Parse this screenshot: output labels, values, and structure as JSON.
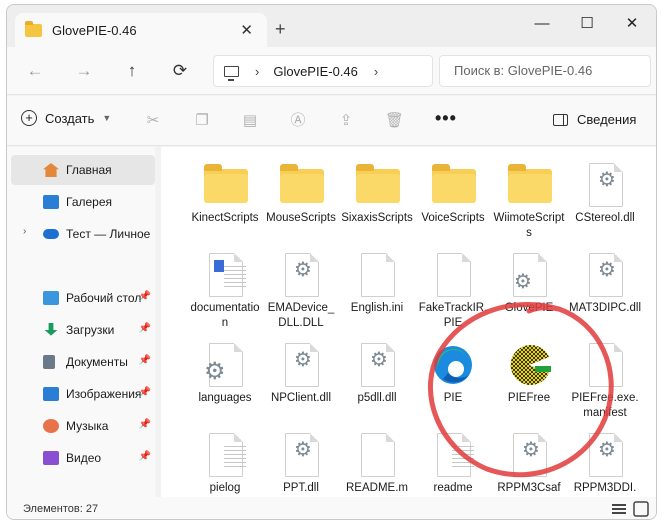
{
  "window": {
    "tab_title": "GlovePIE-0.46",
    "new_tab": "+",
    "close_tab": "✕",
    "minimize": "—",
    "maximize": "☐",
    "close": "✕"
  },
  "nav": {
    "back": "←",
    "forward": "→",
    "up": "↑",
    "refresh": "⟳",
    "path_sep": "›",
    "path_current": "GlovePIE-0.46",
    "search_placeholder": "Поиск в: GlovePIE-0.46"
  },
  "toolbar": {
    "create_label": "Создать",
    "more": "•••",
    "details_label": "Сведения"
  },
  "sidebar": {
    "items": [
      {
        "label": "Главная",
        "icon": "home-icon",
        "color": "#e3873a"
      },
      {
        "label": "Галерея",
        "icon": "gallery-icon",
        "color": "#2a7fd4"
      },
      {
        "label": "Тест — Личное",
        "icon": "onedrive-icon",
        "color": "#1f6fd1"
      },
      {
        "label": "Рабочий стол",
        "icon": "desktop-icon",
        "color": "#3a96dd"
      },
      {
        "label": "Загрузки",
        "icon": "downloads-icon",
        "color": "#1a9a5c"
      },
      {
        "label": "Документы",
        "icon": "documents-icon",
        "color": "#6b7a8a"
      },
      {
        "label": "Изображения",
        "icon": "pictures-icon",
        "color": "#2a7fd4"
      },
      {
        "label": "Музыка",
        "icon": "music-icon",
        "color": "#e8734a"
      },
      {
        "label": "Видео",
        "icon": "videos-icon",
        "color": "#8a4fd1"
      }
    ]
  },
  "files": [
    {
      "name": "KinectScripts",
      "type": "folder"
    },
    {
      "name": "MouseScripts",
      "type": "folder"
    },
    {
      "name": "SixaxisScripts",
      "type": "folder"
    },
    {
      "name": "VoiceScripts",
      "type": "folder"
    },
    {
      "name": "WiimoteScripts",
      "type": "folder"
    },
    {
      "name": "CStereol.dll",
      "type": "dll"
    },
    {
      "name": "documentation",
      "type": "doc"
    },
    {
      "name": "EMADevice_DLL.DLL",
      "type": "dll"
    },
    {
      "name": "English.ini",
      "type": "page"
    },
    {
      "name": "FakeTrackIR.PIE",
      "type": "page"
    },
    {
      "name": "GlovePIE",
      "type": "dll"
    },
    {
      "name": "MAT3DIPC.dll",
      "type": "dll"
    },
    {
      "name": "languages",
      "type": "gears"
    },
    {
      "name": "NPClient.dll",
      "type": "dll"
    },
    {
      "name": "p5dll.dll",
      "type": "dll"
    },
    {
      "name": "PIE",
      "type": "edge"
    },
    {
      "name": "PIEFree",
      "type": "piefree"
    },
    {
      "name": "PIEFree.exe.manifest",
      "type": "page"
    },
    {
      "name": "pielog",
      "type": "text"
    },
    {
      "name": "PPT.dll",
      "type": "dll"
    },
    {
      "name": "README.m",
      "type": "page"
    },
    {
      "name": "readme",
      "type": "text"
    },
    {
      "name": "RPPM3Csaf",
      "type": "dll"
    },
    {
      "name": "RPPM3DDI.",
      "type": "dll"
    }
  ],
  "status": {
    "count_label": "Элементов: 27"
  },
  "annotation": {
    "circle_color": "#e23a3a"
  }
}
